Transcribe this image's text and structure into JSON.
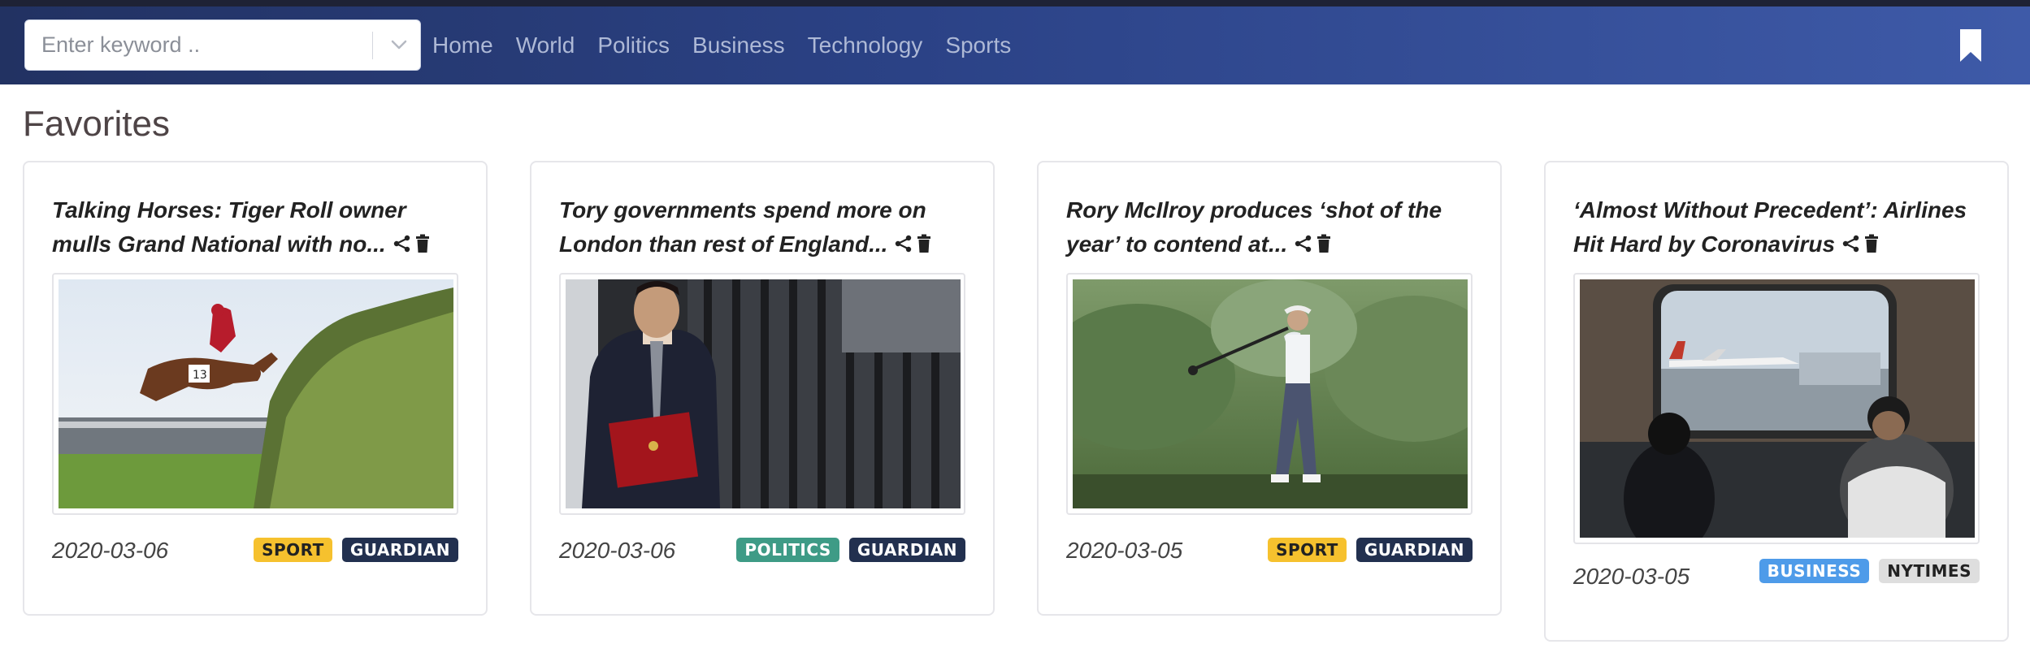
{
  "colors": {
    "navbar_start": "#223262",
    "navbar_end": "#3e5aa8",
    "nav_link": "#aeb9d6",
    "badge_sport": "#f6c12e",
    "badge_politics": "#3e9b86",
    "badge_business": "#4e9be9",
    "badge_guardian": "#22304f",
    "badge_nytimes": "#dedede"
  },
  "search": {
    "placeholder": "Enter keyword ..",
    "dropdown_icon": "chevron-down-icon"
  },
  "nav": {
    "links": [
      "Home",
      "World",
      "Politics",
      "Business",
      "Technology",
      "Sports"
    ],
    "bookmark_icon": "bookmark-icon"
  },
  "page": {
    "title": "Favorites"
  },
  "cards": [
    {
      "title": "Talking Horses: Tiger Roll owner mulls Grand National with no...",
      "image": "horse-jumping-fence-photo",
      "date": "2020-03-06",
      "badges": [
        {
          "label": "SPORT",
          "color": "#f6c12e"
        },
        {
          "label": "GUARDIAN",
          "color": "#22304f"
        }
      ]
    },
    {
      "title": "Tory governments spend more on London than rest of England...",
      "image": "man-holding-red-folder-photo",
      "date": "2020-03-06",
      "badges": [
        {
          "label": "POLITICS",
          "color": "#3e9b86"
        },
        {
          "label": "GUARDIAN",
          "color": "#22304f"
        }
      ]
    },
    {
      "title": "Rory McIlroy produces ‘shot of the year’ to contend at...",
      "image": "golfer-swing-photo",
      "date": "2020-03-05",
      "badges": [
        {
          "label": "SPORT",
          "color": "#f6c12e"
        },
        {
          "label": "GUARDIAN",
          "color": "#22304f"
        }
      ]
    },
    {
      "title": "‘Almost Without Precedent’: Airlines Hit Hard by Coronavirus",
      "image": "airport-train-window-photo",
      "date": "2020-03-05",
      "badges": [
        {
          "label": "BUSINESS",
          "color": "#4e9be9"
        },
        {
          "label": "NYTIMES",
          "color": "#dedede"
        }
      ]
    }
  ]
}
